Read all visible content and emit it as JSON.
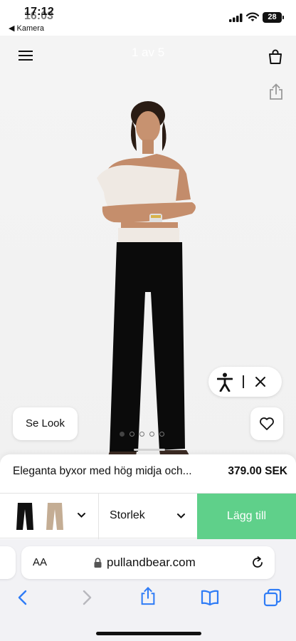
{
  "status_bar": {
    "time": "17:12",
    "time_overlay": "16:03",
    "back_app": "◀ Kamera",
    "battery": "28"
  },
  "gallery": {
    "counter": "1 av 5",
    "look_button": "Se Look",
    "total_images": 5,
    "active_index": 1
  },
  "product": {
    "name": "Eleganta byxor med hög midja och...",
    "price": "379.00 SEK"
  },
  "options": {
    "colors": [
      "black",
      "beige"
    ],
    "size_label": "Storlek",
    "add_button": "Lägg till"
  },
  "browser": {
    "text_size": "AA",
    "url": "pullandbear.com"
  },
  "colors": {
    "add_button": "#5fd08a",
    "swatch_black": "#111111",
    "swatch_beige": "#c4ad94",
    "system_blue": "#2f7cf6"
  },
  "icons": [
    "menu-icon",
    "bag-icon",
    "share-icon",
    "accessibility-icon",
    "close-icon",
    "heart-icon",
    "chevron-down-icon",
    "lock-icon",
    "reload-icon",
    "back-arrow-icon",
    "forward-arrow-icon",
    "bookmarks-icon",
    "tabs-icon"
  ]
}
